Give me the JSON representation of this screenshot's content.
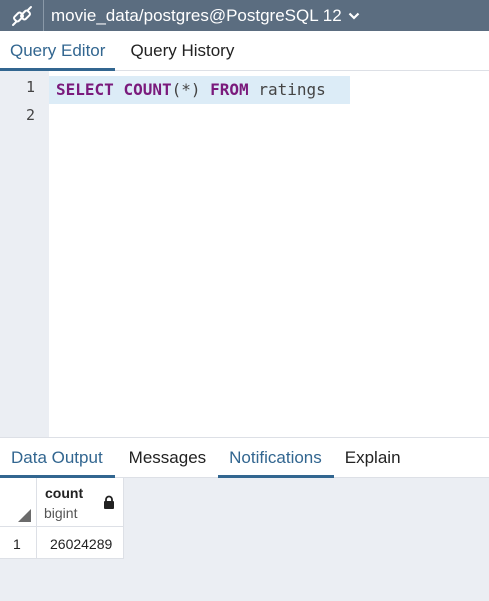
{
  "header": {
    "connection_title": "movie_data/postgres@PostgreSQL 12",
    "icon": "connection-plug-icon",
    "dropdown_icon": "chevron-down-icon",
    "background_color": "#5b6d80"
  },
  "editor_tabs": [
    {
      "label": "Query Editor",
      "active": true
    },
    {
      "label": "Query History",
      "active": false
    }
  ],
  "editor": {
    "line_numbers": [
      "1",
      "2"
    ],
    "query": {
      "kw_select": "SELECT",
      "kw_count": "COUNT",
      "paren": "(*)",
      "kw_from": "FROM",
      "table": "ratings"
    }
  },
  "result_tabs": [
    {
      "label": "Data Output",
      "active": true
    },
    {
      "label": "Messages",
      "active": false
    },
    {
      "label": "Notifications",
      "active": false
    },
    {
      "label": "Explain",
      "active": false
    }
  ],
  "grid": {
    "columns": [
      {
        "name": "count",
        "type": "bigint",
        "icon": "lock-icon"
      }
    ],
    "rows": [
      {
        "row_number": "1",
        "values": [
          "26024289"
        ]
      }
    ]
  },
  "colors": {
    "accent": "#326690",
    "keyword": "#7a1a7c",
    "gutter": "#ebeef3",
    "active_line": "#dcecf7"
  }
}
